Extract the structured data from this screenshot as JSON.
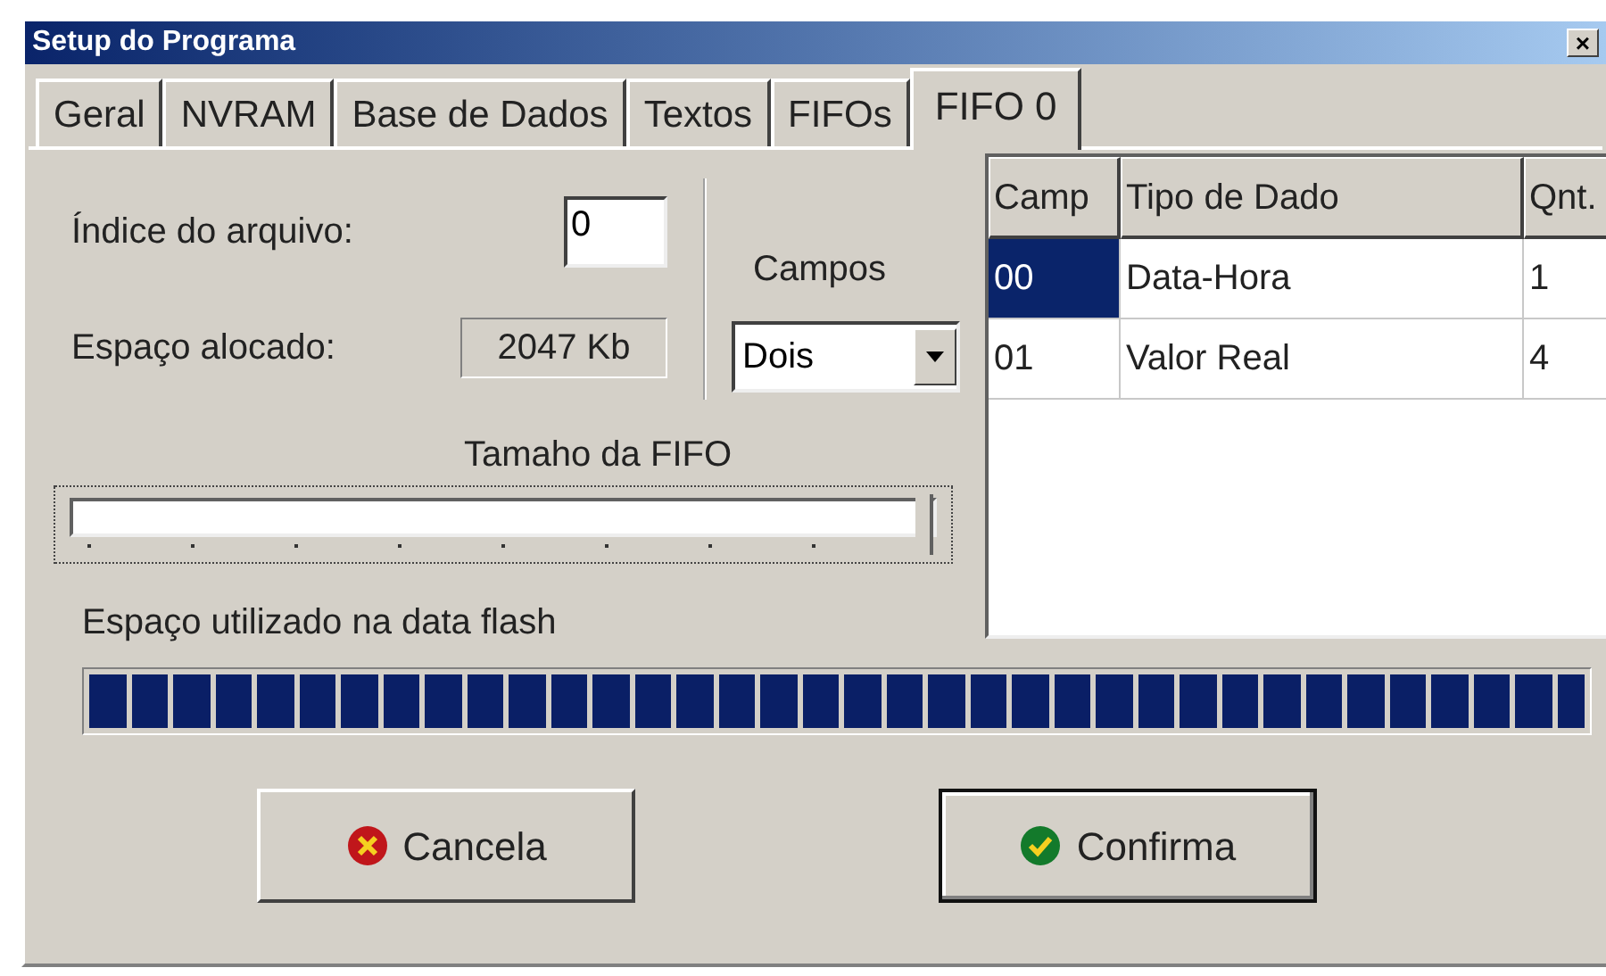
{
  "window": {
    "title": "Setup do Programa",
    "close_label": "×"
  },
  "tabs": [
    {
      "label": "Geral",
      "selected": false
    },
    {
      "label": "NVRAM",
      "selected": false
    },
    {
      "label": "Base de Dados",
      "selected": false
    },
    {
      "label": "Textos",
      "selected": false
    },
    {
      "label": "FIFOs",
      "selected": false
    },
    {
      "label": "FIFO 0",
      "selected": true
    }
  ],
  "file_index": {
    "label": "Índice do arquivo:",
    "value": "0"
  },
  "allocated": {
    "label": "Espaço alocado:",
    "value": "2047 Kb"
  },
  "fields": {
    "label": "Campos",
    "value": "Dois"
  },
  "fifo_size": {
    "label": "Tamaho da FIFO",
    "level": 1.0
  },
  "usage": {
    "label": "Espaço utilizado na data flash",
    "level": 1.0
  },
  "table": {
    "columns": [
      "Camp",
      "Tipo de Dado",
      "Qnt."
    ],
    "rows": [
      {
        "cells": [
          "00",
          "Data-Hora",
          "1"
        ],
        "selected": true
      },
      {
        "cells": [
          "01",
          "Valor Real",
          "4"
        ],
        "selected": false
      }
    ]
  },
  "buttons": [
    {
      "kind": "cancel",
      "label": "Cancela"
    },
    {
      "kind": "confirm",
      "label": "Confirma"
    }
  ]
}
